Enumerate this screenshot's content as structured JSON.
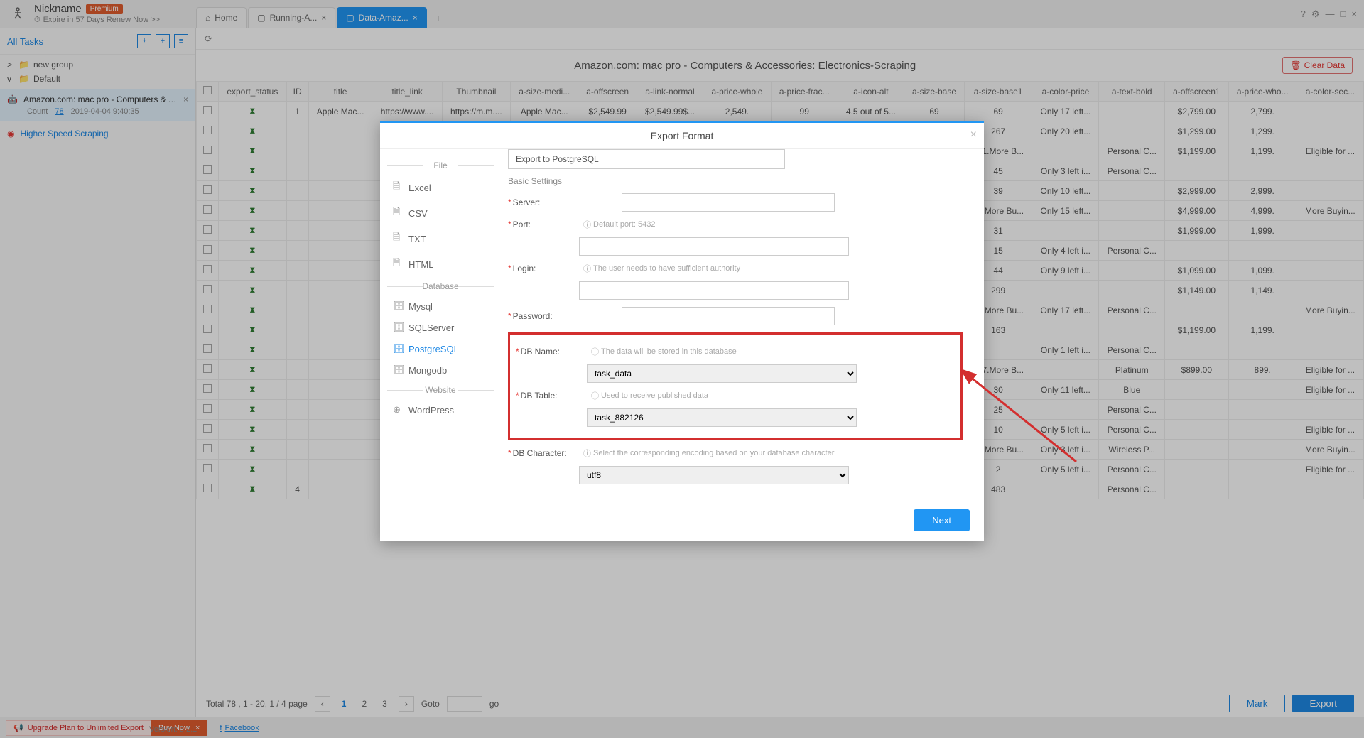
{
  "header": {
    "nickname": "Nickname",
    "premium_badge": "Premium",
    "expire_text": "Expire in 57 Days  Renew Now >>"
  },
  "tabs": [
    {
      "label": "Home",
      "closable": false,
      "home": true
    },
    {
      "label": "Running-A...",
      "closable": true
    },
    {
      "label": "Data-Amaz...",
      "closable": true,
      "active": true
    }
  ],
  "sidebar": {
    "all_tasks": "All Tasks",
    "tree": [
      {
        "caret": ">",
        "label": "new group"
      },
      {
        "caret": "v",
        "label": "Default"
      }
    ],
    "task": {
      "title": "Amazon.com: mac pro - Computers & Acce...",
      "count_label": "Count",
      "count": "78",
      "date": "2019-04-04 9:40:35"
    },
    "speed": "Higher Speed Scraping"
  },
  "page": {
    "title": "Amazon.com: mac pro - Computers & Accessories: Electronics-Scraping",
    "clear": "Clear Data"
  },
  "columns": [
    "",
    "export_status",
    "ID",
    "title",
    "title_link",
    "Thumbnail",
    "a-size-medi...",
    "a-offscreen",
    "a-link-normal",
    "a-price-whole",
    "a-price-frac...",
    "a-icon-alt",
    "a-size-base",
    "a-size-base1",
    "a-color-price",
    "a-text-bold",
    "a-offscreen1",
    "a-price-who...",
    "a-color-sec..."
  ],
  "rows": [
    [
      "",
      "⌛",
      "1",
      "Apple Mac...",
      "https://www....",
      "https://m.m....",
      "Apple Mac...",
      "$2,549.99",
      "$2,549.99$...",
      "2,549.",
      "99",
      "4.5 out of 5...",
      "69",
      "69",
      "Only 17 left...",
      "",
      "$2,799.00",
      "2,799.",
      ""
    ],
    [
      "",
      "⌛",
      "",
      "",
      "",
      "",
      "",
      "",
      "",
      "",
      "",
      "",
      "",
      "267",
      "Only 20 left...",
      "",
      "$1,299.00",
      "1,299.",
      ""
    ],
    [
      "",
      "⌛",
      "",
      "",
      "",
      "",
      "",
      "",
      "",
      "",
      "",
      "",
      "",
      "321.More B...",
      "",
      "Personal C...",
      "$1,199.00",
      "1,199.",
      "Eligible for ..."
    ],
    [
      "",
      "⌛",
      "",
      "",
      "",
      "",
      "",
      "",
      "",
      "",
      "",
      "",
      "",
      "45",
      "Only 3 left i...",
      "Personal C...",
      "",
      "",
      ""
    ],
    [
      "",
      "⌛",
      "",
      "",
      "",
      "",
      "",
      "",
      "",
      "",
      "",
      "",
      "",
      "39",
      "Only 10 left...",
      "",
      "$2,999.00",
      "2,999.",
      ""
    ],
    [
      "",
      "⌛",
      "",
      "",
      "",
      "",
      "",
      "",
      "",
      "",
      "",
      "",
      "",
      "14.More Bu...",
      "Only 15 left...",
      "",
      "$4,999.00",
      "4,999.",
      "More Buyin..."
    ],
    [
      "",
      "⌛",
      "",
      "",
      "",
      "",
      "",
      "",
      "",
      "",
      "",
      "",
      "",
      "31",
      "",
      "",
      "$1,999.00",
      "1,999.",
      ""
    ],
    [
      "",
      "⌛",
      "",
      "",
      "",
      "",
      "",
      "",
      "",
      "",
      "",
      "",
      "",
      "15",
      "Only 4 left i...",
      "Personal C...",
      "",
      "",
      ""
    ],
    [
      "",
      "⌛",
      "",
      "",
      "",
      "",
      "",
      "",
      "",
      "",
      "",
      "",
      "",
      "44",
      "Only 9 left i...",
      "",
      "$1,099.00",
      "1,099.",
      ""
    ],
    [
      "",
      "⌛",
      "",
      "",
      "",
      "",
      "",
      "",
      "",
      "",
      "",
      "",
      "",
      "299",
      "",
      "",
      "$1,149.00",
      "1,149.",
      ""
    ],
    [
      "",
      "⌛",
      "",
      "",
      "",
      "",
      "",
      "",
      "",
      "",
      "",
      "",
      "",
      "24.More Bu...",
      "Only 17 left...",
      "Personal C...",
      "",
      "",
      "More Buyin..."
    ],
    [
      "",
      "⌛",
      "",
      "",
      "",
      "",
      "",
      "",
      "",
      "",
      "",
      "",
      "",
      "163",
      "",
      "",
      "$1,199.00",
      "1,199.",
      ""
    ],
    [
      "",
      "⌛",
      "",
      "",
      "",
      "",
      "",
      "",
      "",
      "",
      "",
      "",
      "",
      "",
      "Only 1 left i...",
      "Personal C...",
      "",
      "",
      ""
    ],
    [
      "",
      "⌛",
      "",
      "",
      "",
      "",
      "",
      "",
      "",
      "",
      "",
      "",
      "",
      "187.More B...",
      "",
      "Platinum",
      "$899.00",
      "899.",
      "Eligible for ..."
    ],
    [
      "",
      "⌛",
      "",
      "",
      "",
      "",
      "",
      "",
      "",
      "",
      "",
      "",
      "",
      "30",
      "Only 11 left...",
      "Blue",
      "",
      "",
      "Eligible for ..."
    ],
    [
      "",
      "⌛",
      "",
      "",
      "",
      "",
      "",
      "",
      "",
      "",
      "",
      "",
      "",
      "25",
      "",
      "Personal C...",
      "",
      "",
      ""
    ],
    [
      "",
      "⌛",
      "",
      "",
      "",
      "",
      "",
      "",
      "",
      "",
      "",
      "",
      "",
      "10",
      "Only 5 left i...",
      "Personal C...",
      "",
      "",
      "Eligible for ..."
    ],
    [
      "",
      "⌛",
      "",
      "",
      "",
      "",
      "",
      "",
      "",
      "",
      "",
      "",
      "",
      "22.More Bu...",
      "Only 3 left i...",
      "Wireless P...",
      "",
      "",
      "More Buyin..."
    ],
    [
      "",
      "⌛",
      "",
      "",
      "",
      "",
      "",
      "",
      "",
      "",
      "",
      "",
      "",
      "2",
      "Only 5 left i...",
      "Personal C...",
      "",
      "",
      "Eligible for ..."
    ],
    [
      "",
      "⌛",
      "4",
      "",
      "",
      "",
      "",
      "",
      "",
      "",
      "",
      "",
      "",
      "483",
      "",
      "Personal C...",
      "",
      "",
      ""
    ]
  ],
  "pager": {
    "summary": "Total  78 ,  1  - 20,  1  /  4  page",
    "pages": [
      "1",
      "2",
      "3"
    ],
    "goto": "Goto",
    "go": "go",
    "mark": "Mark",
    "export": "Export"
  },
  "bottom": {
    "upgrade": "Upgrade Plan to Unlimited Export",
    "buy": "Buy Now",
    "facebook": "Facebook",
    "version": "Version: 3.2.1"
  },
  "dialog": {
    "title": "Export Format",
    "sections": {
      "file": "File",
      "database": "Database",
      "website": "Website"
    },
    "items": {
      "excel": "Excel",
      "csv": "CSV",
      "txt": "TXT",
      "html": "HTML",
      "mysql": "Mysql",
      "sqlserver": "SQLServer",
      "postgresql": "PostgreSQL",
      "mongodb": "Mongodb",
      "wordpress": "WordPress"
    },
    "mode": "Export to PostgreSQL",
    "basic": "Basic Settings",
    "fields": {
      "server": {
        "label": "Server:",
        "value": ""
      },
      "port": {
        "label": "Port:",
        "hint": "Default port: 5432",
        "value": ""
      },
      "login": {
        "label": "Login:",
        "hint": "The user needs to have sufficient authority",
        "value": ""
      },
      "password": {
        "label": "Password:",
        "value": ""
      },
      "dbname": {
        "label": "DB Name:",
        "hint": "The data will be stored in this database",
        "value": "task_data"
      },
      "dbtable": {
        "label": "DB Table:",
        "hint": "Used to receive published data",
        "value": "task_882126"
      },
      "dbchar": {
        "label": "DB Character:",
        "hint": "Select the corresponding encoding based on your database character",
        "value": "utf8"
      }
    },
    "next": "Next"
  }
}
